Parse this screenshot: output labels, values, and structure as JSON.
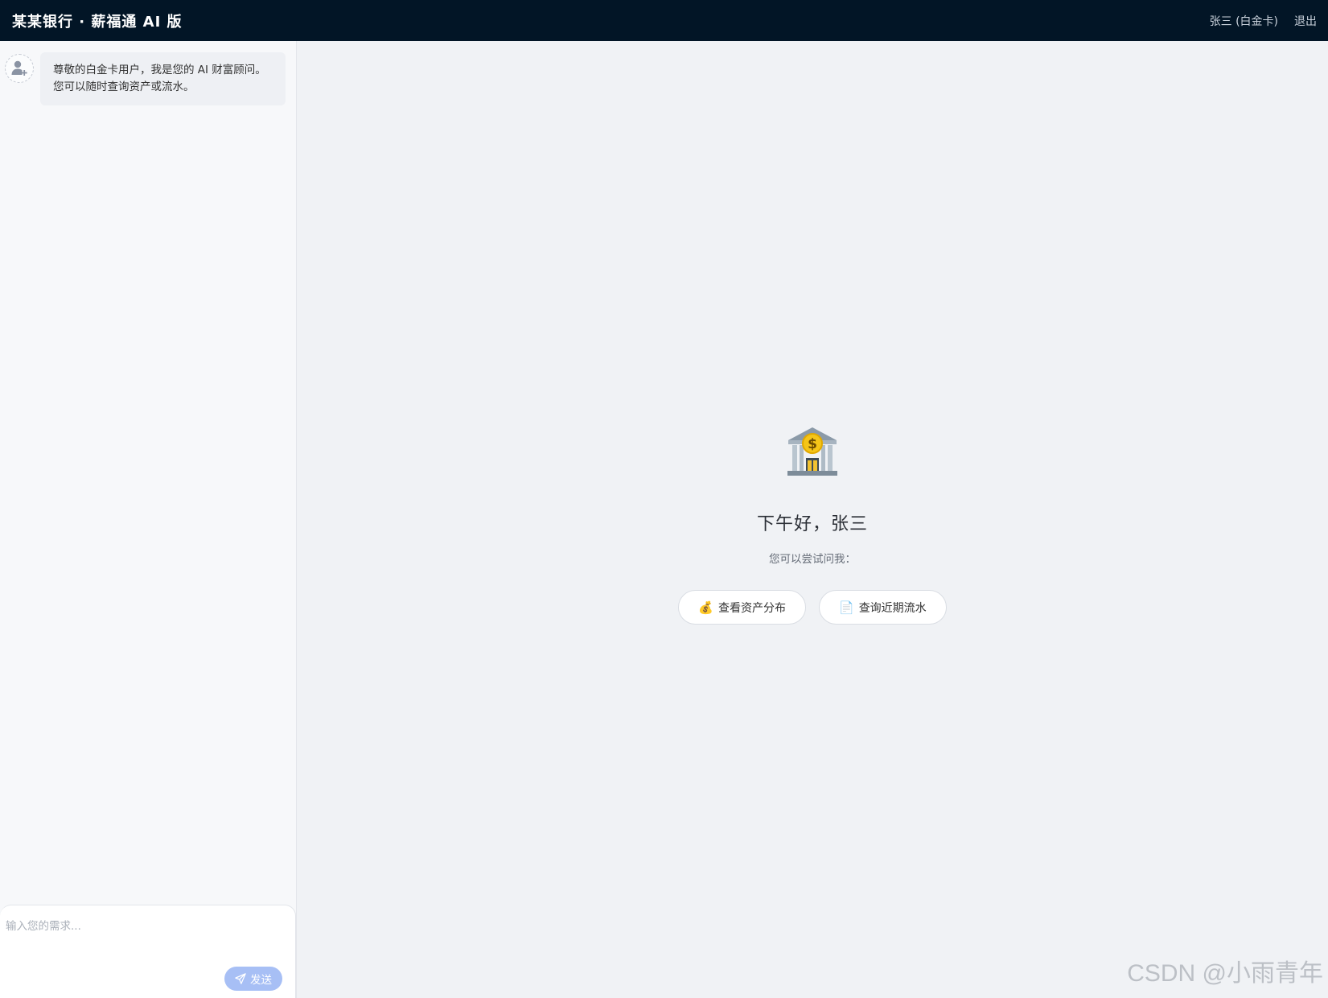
{
  "header": {
    "title": "某某银行 · 薪福通 AI 版",
    "user_label": "张三 (白金卡)",
    "logout_label": "退出"
  },
  "chat": {
    "messages": [
      {
        "sender": "assistant",
        "line1": "尊敬的白金卡用户，我是您的 AI 财富顾问。",
        "line2": "您可以随时查询资产或流水。"
      }
    ],
    "input": {
      "placeholder": "输入您的需求...",
      "value": ""
    },
    "send_label": "发送"
  },
  "welcome": {
    "icon": "bank-icon",
    "greeting": "下午好，张三",
    "hint": "您可以尝试问我：",
    "suggestions": [
      {
        "emoji": "💰",
        "label": "查看资产分布"
      },
      {
        "emoji": "📄",
        "label": "查询近期流水"
      }
    ]
  },
  "watermark": "CSDN @小雨青年",
  "colors": {
    "topbar_bg": "#021526",
    "send_button": "#a7bff5",
    "page_bg": "#f0f2f5"
  }
}
